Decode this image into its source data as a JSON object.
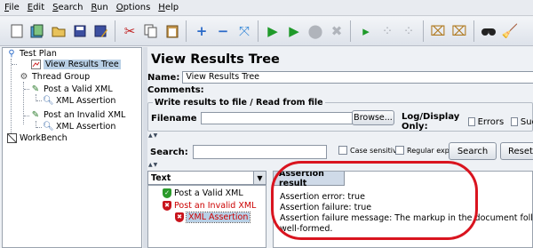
{
  "menu": [
    {
      "label": "File",
      "mnemonic": "F",
      "rest": "ile"
    },
    {
      "label": "Edit",
      "mnemonic": "E",
      "rest": "dit"
    },
    {
      "label": "Search",
      "mnemonic": "S",
      "rest": "earch"
    },
    {
      "label": "Run",
      "mnemonic": "R",
      "rest": "un"
    },
    {
      "label": "Options",
      "mnemonic": "O",
      "rest": "ptions"
    },
    {
      "label": "Help",
      "mnemonic": "H",
      "rest": "elp"
    }
  ],
  "toolbar_icons": [
    "new-icon",
    "templates-icon",
    "open-icon",
    "save-icon",
    "save-as-icon",
    "cut-icon",
    "copy-icon",
    "paste-icon",
    "expand-icon",
    "collapse-icon",
    "toggle-icon",
    "start-icon",
    "start-no-pauses-icon",
    "stop-icon",
    "shutdown-icon",
    "remote-start-icon",
    "remote-stop-icon",
    "remote-shutdown-icon",
    "clear-icon",
    "clear-all-icon",
    "search-icon",
    "reset-search-icon"
  ],
  "tree": {
    "test_plan": "Test Plan",
    "view_results_tree": "View Results Tree",
    "thread_group": "Thread Group",
    "post_valid_xml": "Post a Valid XML",
    "xml_assertion_1": "XML Assertion",
    "post_invalid_xml": "Post an Invalid XML",
    "xml_assertion_2": "XML Assertion",
    "workbench": "WorkBench"
  },
  "main": {
    "title": "View Results Tree",
    "name_label": "Name:",
    "name_value": "View Results Tree",
    "comments_label": "Comments:",
    "write_results_title": "Write results to file / Read from file",
    "filename_label": "Filename",
    "filename_value": "",
    "browse_label": "Browse...",
    "log_display_label": "Log/Display Only:",
    "errors_label": "Errors",
    "successes_label": "Suc",
    "search_label": "Search:",
    "search_value": "",
    "case_sensitive_label": "Case sensitive",
    "regular_exp_label": "Regular exp.",
    "search_button": "Search",
    "reset_button": "Reset"
  },
  "results": {
    "renderer": "Text",
    "items": [
      {
        "label": "Post a Valid XML",
        "status": "success"
      },
      {
        "label": "Post an Invalid XML",
        "status": "failure"
      },
      {
        "label": "XML Assertion",
        "status": "failure",
        "selected": true
      }
    ]
  },
  "assertion": {
    "tab_label": "Assertion result",
    "lines": [
      "Assertion error: true",
      "Assertion failure: true",
      "Assertion failure message: The markup in the document following the roo",
      "well-formed."
    ]
  },
  "colors": {
    "selection": "#b8cfe5",
    "error_text": "#cc0000",
    "annotation": "#d9141f",
    "success": "#2a9a2a",
    "failure": "#c8141c"
  }
}
